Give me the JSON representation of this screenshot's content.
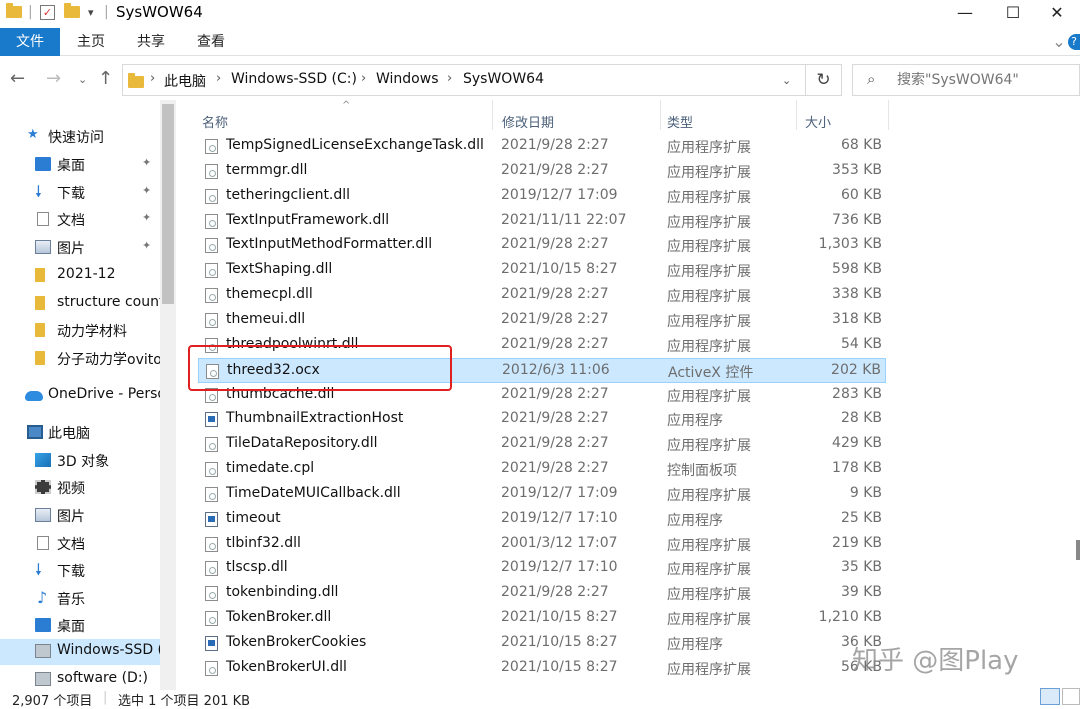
{
  "window": {
    "title": "SysWOW64",
    "minimize": "—",
    "maximize": "☐",
    "close": "✕"
  },
  "ribbon": {
    "tabs": [
      "文件",
      "主页",
      "共享",
      "查看"
    ],
    "expand": "⌄",
    "help": "?"
  },
  "address": {
    "crumbs": [
      "此电脑",
      "Windows-SSD (C:)",
      "Windows",
      "SysWOW64"
    ],
    "search_placeholder": "搜索\"SysWOW64\""
  },
  "nav": {
    "items": [
      {
        "label": "快速访问",
        "icon": "star-icon"
      },
      {
        "label": "桌面",
        "icon": "desktop-icon",
        "pinned": true
      },
      {
        "label": "下载",
        "icon": "download-icon",
        "pinned": true
      },
      {
        "label": "文档",
        "icon": "document-icon",
        "pinned": true
      },
      {
        "label": "图片",
        "icon": "pictures-icon",
        "pinned": true
      },
      {
        "label": "2021-12",
        "icon": "folder-icon"
      },
      {
        "label": "structure count",
        "icon": "folder-icon"
      },
      {
        "label": "动力学材料",
        "icon": "folder-icon"
      },
      {
        "label": "分子动力学ovito",
        "icon": "folder-icon"
      },
      {
        "label": "OneDrive - Perso",
        "icon": "onedrive-icon"
      },
      {
        "label": "此电脑",
        "icon": "this-pc-icon"
      },
      {
        "label": "3D 对象",
        "icon": "3d-objects-icon"
      },
      {
        "label": "视频",
        "icon": "videos-icon"
      },
      {
        "label": "图片",
        "icon": "pictures-icon"
      },
      {
        "label": "文档",
        "icon": "document-icon"
      },
      {
        "label": "下载",
        "icon": "download-icon"
      },
      {
        "label": "音乐",
        "icon": "music-icon"
      },
      {
        "label": "桌面",
        "icon": "desktop-icon"
      },
      {
        "label": "Windows-SSD (",
        "icon": "drive-icon",
        "selected": true
      },
      {
        "label": "software (D:)",
        "icon": "drive-icon"
      }
    ]
  },
  "columns": {
    "name": "名称",
    "date": "修改日期",
    "type": "类型",
    "size": "大小"
  },
  "files": [
    {
      "name": "TempSignedLicenseExchangeTask.dll",
      "date": "2021/9/28 2:27",
      "type": "应用程序扩展",
      "size": "68 KB",
      "kind": "dll"
    },
    {
      "name": "termmgr.dll",
      "date": "2021/9/28 2:27",
      "type": "应用程序扩展",
      "size": "353 KB",
      "kind": "dll"
    },
    {
      "name": "tetheringclient.dll",
      "date": "2019/12/7 17:09",
      "type": "应用程序扩展",
      "size": "60 KB",
      "kind": "dll"
    },
    {
      "name": "TextInputFramework.dll",
      "date": "2021/11/11 22:07",
      "type": "应用程序扩展",
      "size": "736 KB",
      "kind": "dll"
    },
    {
      "name": "TextInputMethodFormatter.dll",
      "date": "2021/9/28 2:27",
      "type": "应用程序扩展",
      "size": "1,303 KB",
      "kind": "dll"
    },
    {
      "name": "TextShaping.dll",
      "date": "2021/10/15 8:27",
      "type": "应用程序扩展",
      "size": "598 KB",
      "kind": "dll"
    },
    {
      "name": "themecpl.dll",
      "date": "2021/9/28 2:27",
      "type": "应用程序扩展",
      "size": "338 KB",
      "kind": "dll"
    },
    {
      "name": "themeui.dll",
      "date": "2021/9/28 2:27",
      "type": "应用程序扩展",
      "size": "318 KB",
      "kind": "dll"
    },
    {
      "name": "threadpoolwinrt.dll",
      "date": "2021/9/28 2:27",
      "type": "应用程序扩展",
      "size": "54 KB",
      "kind": "dll"
    },
    {
      "name": "threed32.ocx",
      "date": "2012/6/3 11:06",
      "type": "ActiveX 控件",
      "size": "202 KB",
      "kind": "dll",
      "selected": true
    },
    {
      "name": "thumbcache.dll",
      "date": "2021/9/28 2:27",
      "type": "应用程序扩展",
      "size": "283 KB",
      "kind": "dll"
    },
    {
      "name": "ThumbnailExtractionHost",
      "date": "2021/9/28 2:27",
      "type": "应用程序",
      "size": "28 KB",
      "kind": "app"
    },
    {
      "name": "TileDataRepository.dll",
      "date": "2021/9/28 2:27",
      "type": "应用程序扩展",
      "size": "429 KB",
      "kind": "dll"
    },
    {
      "name": "timedate.cpl",
      "date": "2021/9/28 2:27",
      "type": "控制面板项",
      "size": "178 KB",
      "kind": "dll"
    },
    {
      "name": "TimeDateMUICallback.dll",
      "date": "2019/12/7 17:09",
      "type": "应用程序扩展",
      "size": "9 KB",
      "kind": "dll"
    },
    {
      "name": "timeout",
      "date": "2019/12/7 17:10",
      "type": "应用程序",
      "size": "25 KB",
      "kind": "app"
    },
    {
      "name": "tlbinf32.dll",
      "date": "2001/3/12 17:07",
      "type": "应用程序扩展",
      "size": "219 KB",
      "kind": "dll"
    },
    {
      "name": "tlscsp.dll",
      "date": "2019/12/7 17:10",
      "type": "应用程序扩展",
      "size": "35 KB",
      "kind": "dll"
    },
    {
      "name": "tokenbinding.dll",
      "date": "2021/9/28 2:27",
      "type": "应用程序扩展",
      "size": "39 KB",
      "kind": "dll"
    },
    {
      "name": "TokenBroker.dll",
      "date": "2021/10/15 8:27",
      "type": "应用程序扩展",
      "size": "1,210 KB",
      "kind": "dll"
    },
    {
      "name": "TokenBrokerCookies",
      "date": "2021/10/15 8:27",
      "type": "应用程序",
      "size": "36 KB",
      "kind": "app"
    },
    {
      "name": "TokenBrokerUI.dll",
      "date": "2021/10/15 8:27",
      "type": "应用程序扩展",
      "size": "56 KB",
      "kind": "dll"
    }
  ],
  "status": {
    "count": "2,907 个项目",
    "selected": "选中 1 个项目  201 KB"
  },
  "watermark": "知乎 @图Play",
  "colors": {
    "accent": "#1979ca",
    "selection": "#cce8ff",
    "highlight_box": "#e02020"
  }
}
